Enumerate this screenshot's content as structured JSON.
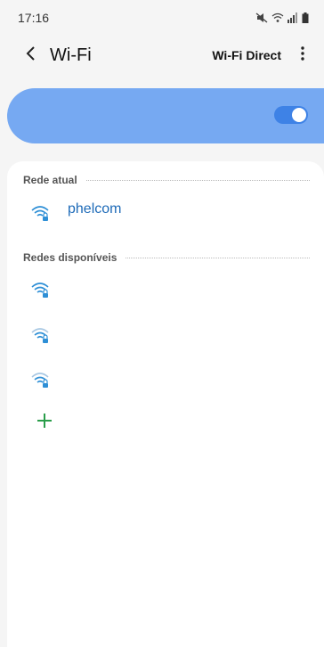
{
  "status_bar": {
    "time": "17:16",
    "icons": [
      "mute-icon",
      "wifi-icon",
      "signal-icon",
      "battery-icon"
    ]
  },
  "app_bar": {
    "title": "Wi-Fi",
    "wifi_direct_label": "Wi-Fi Direct",
    "more_icon": "more-vert-icon",
    "back_icon": "back-chevron-icon"
  },
  "master_switch": {
    "state": "on",
    "color": "#76a9f2",
    "toggle_color": "#3e82e6"
  },
  "current_network": {
    "header": "Rede atual",
    "items": [
      {
        "name": "phelcom",
        "icon": "wifi-locked-icon",
        "strength": "strong"
      }
    ]
  },
  "available_networks": {
    "header": "Redes disponíveis",
    "items": [
      {
        "name": "",
        "icon": "wifi-locked-icon",
        "strength": "strong"
      },
      {
        "name": "",
        "icon": "wifi-locked-icon",
        "strength": "medium"
      },
      {
        "name": "",
        "icon": "wifi-locked-icon",
        "strength": "medium"
      }
    ]
  },
  "add_network": {
    "icon": "plus-icon",
    "color": "#2a9d4a"
  },
  "colors": {
    "accent": "#1e6bb8",
    "wifi_strong": "#2e8fd6",
    "wifi_weak": "#7fb3dd"
  }
}
